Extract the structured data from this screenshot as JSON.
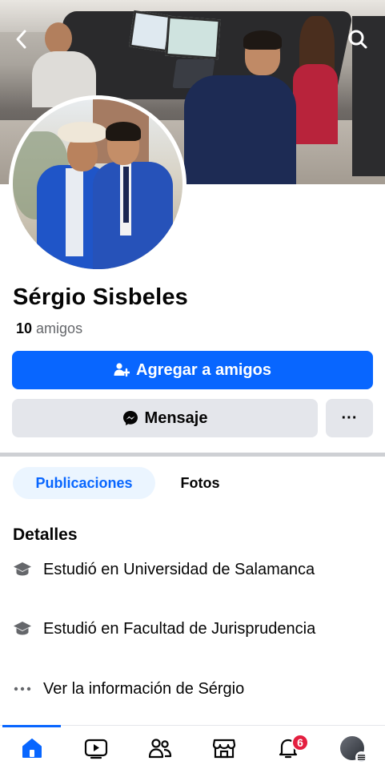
{
  "profile": {
    "name": "Sérgio Sisbeles",
    "friends_count": "10",
    "friends_label": "amigos"
  },
  "actions": {
    "add_friend_label": "Agregar a amigos",
    "message_label": "Mensaje",
    "more_label": "···"
  },
  "tabs": [
    {
      "label": "Publicaciones",
      "active": true
    },
    {
      "label": "Fotos",
      "active": false
    }
  ],
  "details": {
    "title": "Detalles",
    "items": [
      {
        "icon": "graduation-cap-icon",
        "text": "Estudió en Universidad de Salamanca"
      },
      {
        "icon": "graduation-cap-icon",
        "text": "Estudió en Facultad de Jurisprudencia"
      },
      {
        "icon": "more-dots-icon",
        "text": "Ver la información de Sérgio"
      }
    ]
  },
  "bottom_nav": {
    "items": [
      {
        "name": "home-icon",
        "active": true
      },
      {
        "name": "video-icon",
        "active": false
      },
      {
        "name": "friends-icon",
        "active": false
      },
      {
        "name": "marketplace-icon",
        "active": false
      },
      {
        "name": "notifications-icon",
        "active": false
      },
      {
        "name": "profile-menu-avatar",
        "active": false
      }
    ],
    "notifications_badge": "6"
  },
  "colors": {
    "primary": "#0866ff",
    "secondary_button": "#e4e6eb",
    "badge": "#e41e3f",
    "active_tab_bg": "#ebf5ff"
  }
}
